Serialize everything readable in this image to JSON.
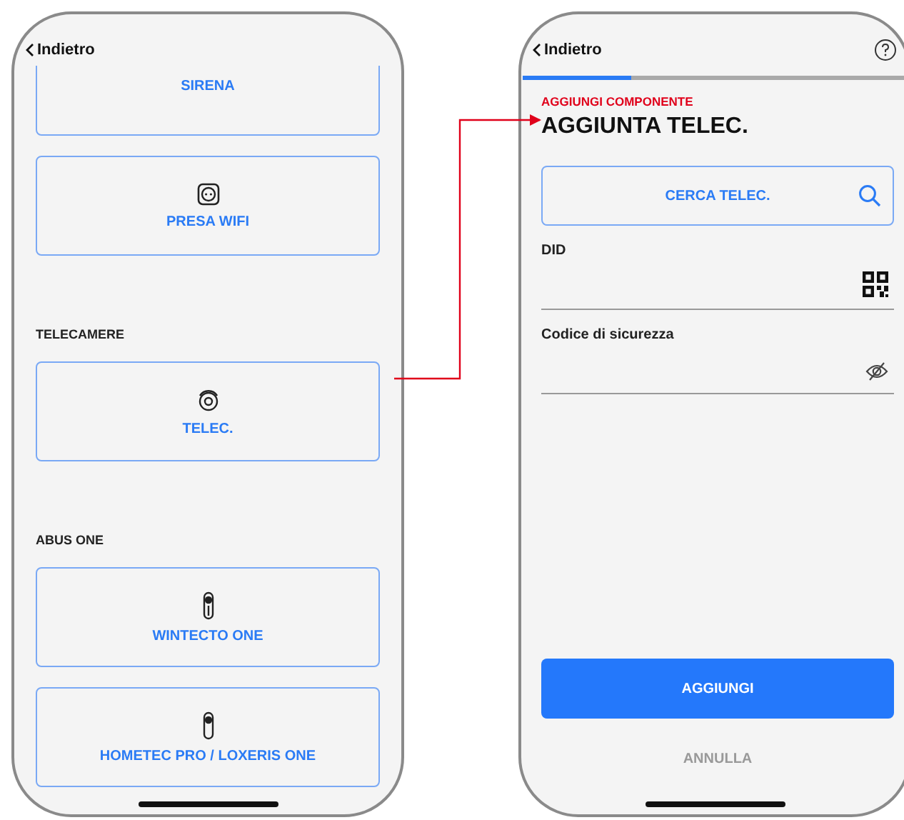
{
  "left_screen": {
    "back": "Indietro",
    "list": [
      {
        "kind": "card",
        "label": "SIRENA"
      },
      {
        "kind": "card",
        "label": "PRESA WIFI"
      },
      {
        "kind": "section",
        "label": "TELECAMERE"
      },
      {
        "kind": "card",
        "label": "TELEC."
      },
      {
        "kind": "section",
        "label": "ABUS ONE"
      },
      {
        "kind": "card",
        "label": "WINTECTO ONE"
      },
      {
        "kind": "card",
        "label": "HOMETEC PRO / LOXERIS ONE"
      }
    ]
  },
  "right_screen": {
    "back": "Indietro",
    "progress": {
      "level": 0.28
    },
    "eyebrow": "AGGIUNGI COMPONENTE",
    "title": "AGGIUNTA TELEC.",
    "search_button": "CERCA TELEC.",
    "fields": [
      {
        "label": "DID"
      },
      {
        "label": "Codice di sicurezza"
      }
    ],
    "primary_button": "AGGIUNGI",
    "cancel_button": "ANNULLA"
  }
}
